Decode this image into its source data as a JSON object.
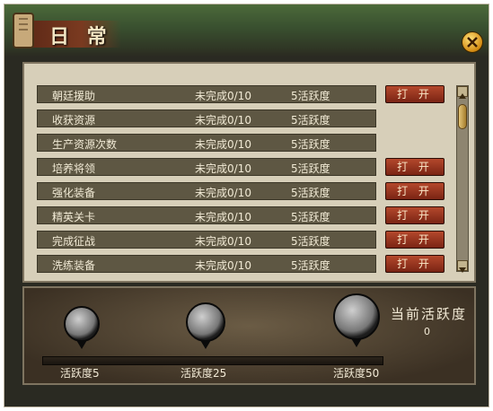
{
  "window": {
    "title": "日 常"
  },
  "tasks": [
    {
      "name": "朝廷援助",
      "status": "未完成0/10",
      "reward": "5活跃度",
      "has_button": true
    },
    {
      "name": "收获资源",
      "status": "未完成0/10",
      "reward": "5活跃度",
      "has_button": false
    },
    {
      "name": "生产资源次数",
      "status": "未完成0/10",
      "reward": "5活跃度",
      "has_button": false
    },
    {
      "name": "培养将领",
      "status": "未完成0/10",
      "reward": "5活跃度",
      "has_button": true
    },
    {
      "name": "强化装备",
      "status": "未完成0/10",
      "reward": "5活跃度",
      "has_button": true
    },
    {
      "name": "精英关卡",
      "status": "未完成0/10",
      "reward": "5活跃度",
      "has_button": true
    },
    {
      "name": "完成征战",
      "status": "未完成0/10",
      "reward": "5活跃度",
      "has_button": true
    },
    {
      "name": "洗练装备",
      "status": "未完成0/10",
      "reward": "5活跃度",
      "has_button": true
    }
  ],
  "open_button_label": "打 开",
  "activity": {
    "title": "当前活跃度",
    "value": "0",
    "milestones": [
      "活跃度5",
      "活跃度25",
      "活跃度50"
    ]
  },
  "icons": {
    "close": "close-icon",
    "scroll_up": "arrow-up-icon",
    "scroll_down": "arrow-down-icon",
    "reward": "money-bag-icon"
  }
}
